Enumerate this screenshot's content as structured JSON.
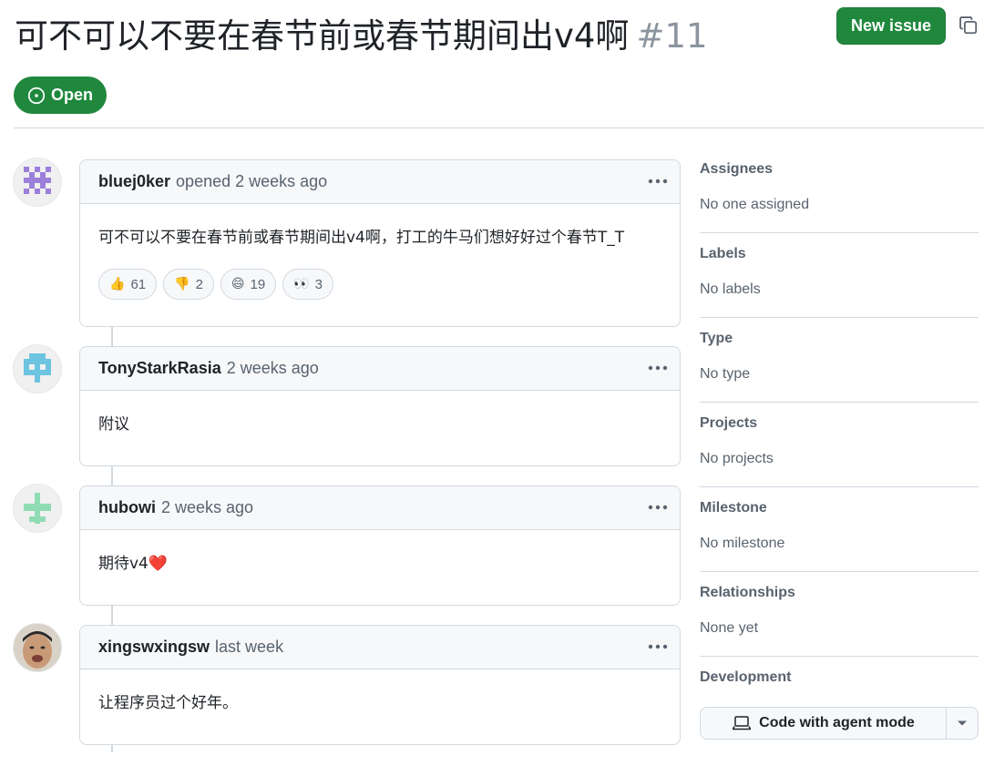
{
  "issue": {
    "title": "可不可以不要在春节前或春节期间出v4啊",
    "number": "#11",
    "state": "Open",
    "new_issue_label": "New issue"
  },
  "comments": [
    {
      "author": "bluej0ker",
      "meta": "opened 2 weeks ago",
      "body": "可不可以不要在春节前或春节期间出v4啊，打工的牛马们想好好过个春节T_T",
      "reactions": [
        {
          "emoji": "👍",
          "count": "61"
        },
        {
          "emoji": "👎",
          "count": "2"
        },
        {
          "emoji": "😄",
          "count": "19"
        },
        {
          "emoji": "👀",
          "count": "3"
        }
      ]
    },
    {
      "author": "TonyStarkRasia",
      "meta": "2 weeks ago",
      "body": "附议"
    },
    {
      "author": "hubowi",
      "meta": "2 weeks ago",
      "body": "期待v4❤️"
    },
    {
      "author": "xingswxingsw",
      "meta": "last week",
      "body": "让程序员过个好年。"
    }
  ],
  "sidebar": {
    "sections": [
      {
        "label": "Assignees",
        "value": "No one assigned"
      },
      {
        "label": "Labels",
        "value": "No labels"
      },
      {
        "label": "Type",
        "value": "No type"
      },
      {
        "label": "Projects",
        "value": "No projects"
      },
      {
        "label": "Milestone",
        "value": "No milestone"
      },
      {
        "label": "Relationships",
        "value": "None yet"
      }
    ],
    "development": {
      "label": "Development",
      "agent_button": "Code with agent mode"
    }
  },
  "colors": {
    "open_green": "#1f883d",
    "border": "#d1d9e0",
    "muted_text": "#59636e"
  }
}
